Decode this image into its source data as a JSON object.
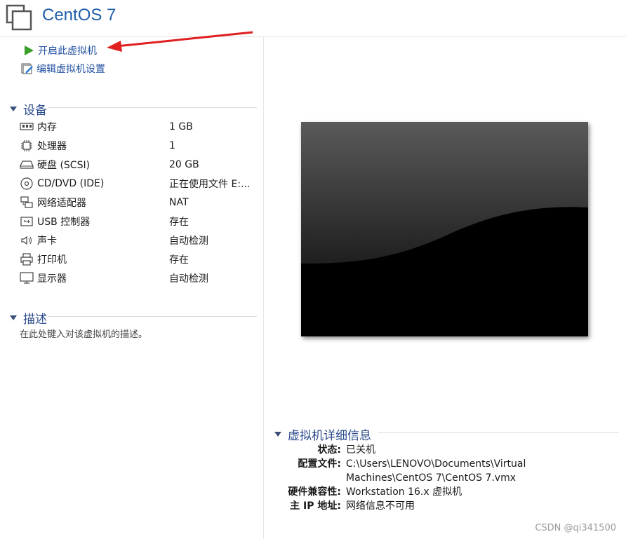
{
  "window": {
    "title": "CentOS 7"
  },
  "actions": [
    {
      "label": "开启此虚拟机",
      "icon": "play-icon"
    },
    {
      "label": "编辑虚拟机设置",
      "icon": "edit-settings-icon"
    }
  ],
  "devices": {
    "heading": "设备",
    "items": [
      {
        "name": "内存",
        "value": "1 GB",
        "icon": "memory-icon"
      },
      {
        "name": "处理器",
        "value": "1",
        "icon": "processor-icon"
      },
      {
        "name": "硬盘 (SCSI)",
        "value": "20 GB",
        "icon": "hard-disk-icon"
      },
      {
        "name": "CD/DVD (IDE)",
        "value": "正在使用文件 E:...",
        "icon": "cd-dvd-icon"
      },
      {
        "name": "网络适配器",
        "value": "NAT",
        "icon": "network-adapter-icon"
      },
      {
        "name": "USB 控制器",
        "value": "存在",
        "icon": "usb-icon"
      },
      {
        "name": "声卡",
        "value": "自动检测",
        "icon": "speaker-icon"
      },
      {
        "name": "打印机",
        "value": "存在",
        "icon": "printer-icon"
      },
      {
        "name": "显示器",
        "value": "自动检测",
        "icon": "display-icon"
      }
    ]
  },
  "description": {
    "heading": "描述",
    "placeholder": "在此处键入对该虚拟机的描述。"
  },
  "vm_details": {
    "heading": "虚拟机详细信息",
    "status_label": "状态:",
    "status_value": "已关机",
    "config_label": "配置文件:",
    "config_value_line1": "C:\\Users\\LENOVO\\Documents\\Virtual",
    "config_value_line2": "Machines\\CentOS 7\\CentOS 7.vmx",
    "compat_label": "硬件兼容性:",
    "compat_value": "Workstation 16.x 虚拟机",
    "ip_label": "主 IP 地址:",
    "ip_value": "网络信息不可用"
  },
  "watermark": "CSDN @qi341500",
  "colors": {
    "accent": "#1f5fa8",
    "arrow": "#e02020",
    "play": "#3aa02a"
  }
}
